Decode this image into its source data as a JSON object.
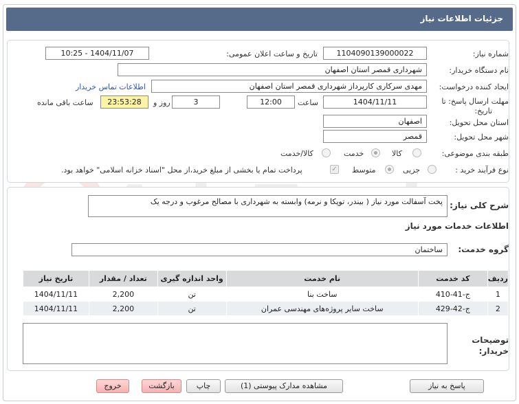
{
  "header": {
    "title": "جزئیات اطلاعات نیاز"
  },
  "fields": {
    "need_number_label": "شماره نیاز:",
    "need_number": "1104090139000022",
    "announce_label": "تاریخ و ساعت اعلان عمومی:",
    "announce_value": "1404/11/07 - 10:25",
    "buyer_org_label": "نام دستگاه خریدار:",
    "buyer_org": "شهرداری قمصر استان اصفهان",
    "requester_label": "ایجاد کننده درخواست:",
    "requester": "مهدی سرکاری کارپرداز شهرداری قمصر استان اصفهان",
    "contact_link": "اطلاعات تماس خریدار",
    "deadline_label_1": "مهلت ارسال پاسخ: تا",
    "deadline_label_2": "تاریخ:",
    "deadline_date": "1404/11/11",
    "time_label": "ساعت",
    "deadline_time": "12:00",
    "days_value": "3",
    "days_label": "روز و",
    "remaining_time": "23:53:28",
    "remaining_label": "ساعت باقی مانده",
    "province_label": "استان محل تحویل:",
    "province": "اصفهان",
    "city_label": "شهر محل تحویل:",
    "city": "قمصر",
    "category_label": "طبقه بندی موضوعی:",
    "category_options": [
      "کالا",
      "خدمت",
      "کالا/خدمت"
    ],
    "process_label": "نوع فرآیند خرید :",
    "process_options": [
      "جزیی",
      "متوسط"
    ],
    "payment_note": "پرداخت تمام یا بخشی از مبلغ خرید،از محل \"اسناد خزانه اسلامی\" خواهد بود."
  },
  "description": {
    "label": "شرح کلی نیاز:",
    "text": "پخت آسفالت مورد نیاز ( بیندر، توپکا و نرمه) وابسته به شهرداری با مصالح مرغوب و درجه یک"
  },
  "services": {
    "section_title": "اطلاعات خدمات مورد نیاز",
    "group_label": "گروه خدمت:",
    "group_value": "ساختمان",
    "columns": [
      "ردیف",
      "کد خدمت",
      "نام خدمت",
      "واحد اندازه گیری",
      "تعداد / مقدار",
      "تاریخ نیاز"
    ],
    "rows": [
      [
        "1",
        "ج-41-410",
        "ساخت بنا",
        "تن",
        "2,200",
        "1404/11/11"
      ],
      [
        "2",
        "ج-42-429",
        "ساخت سایر پروژه‌های مهندسی عمران",
        "تن",
        "2,200",
        "1404/11/11"
      ]
    ]
  },
  "buyer_notes": {
    "label_1": "توضیحات",
    "label_2": "خریدار:",
    "text": ""
  },
  "buttons": {
    "reply": "پاسخ به نیاز",
    "attachments": "مشاهده مدارک پیوستی (1)",
    "print": "چاپ",
    "back": "بازگشت",
    "exit": "خروج"
  },
  "watermark": "AriaTender.net"
}
